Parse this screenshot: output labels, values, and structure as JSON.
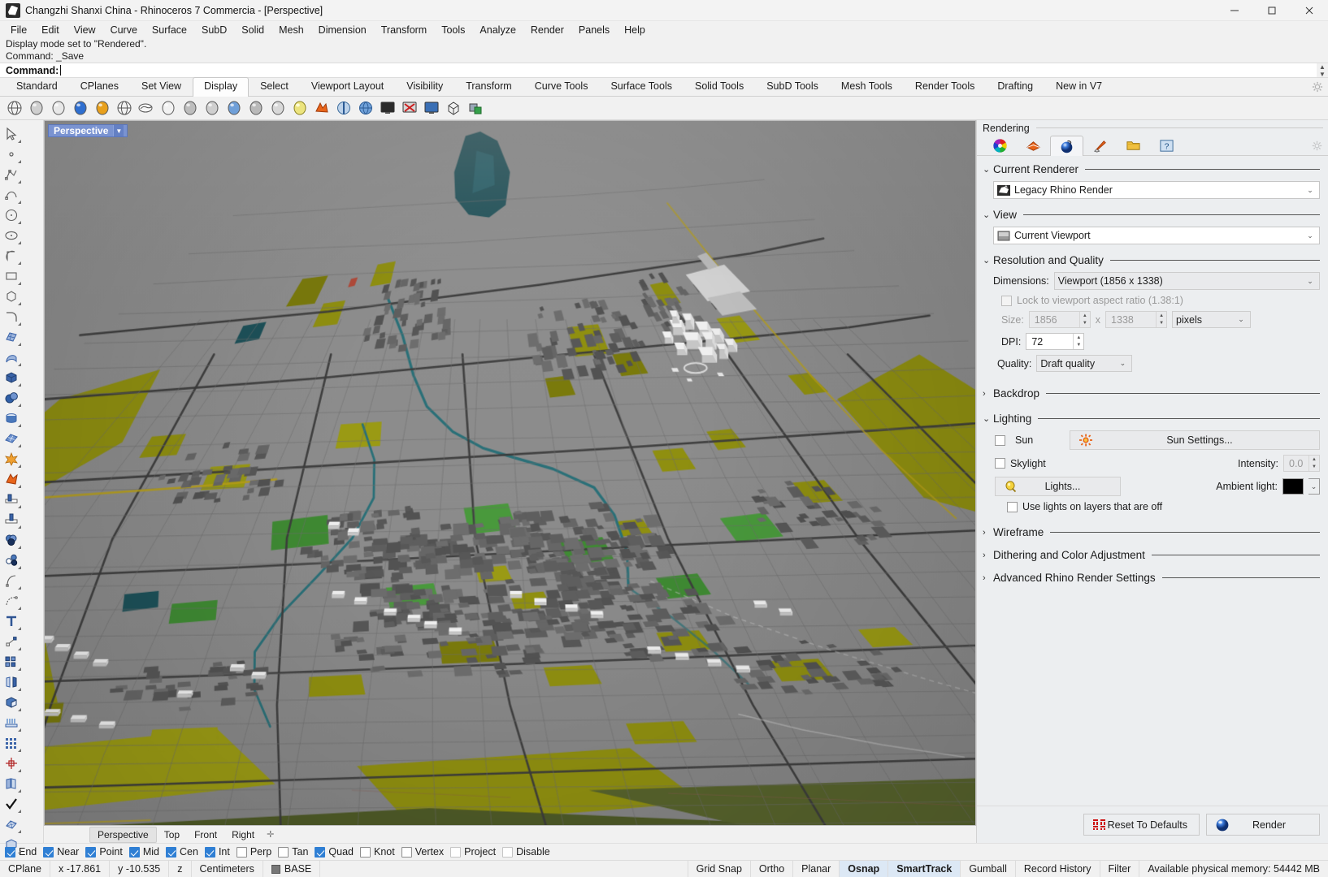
{
  "window": {
    "title": "Changzhi Shanxi China - Rhinoceros 7 Commercia - [Perspective]",
    "app_icon": "rhino-icon",
    "minimize": "—",
    "maximize": "□",
    "close": "✕"
  },
  "menubar": {
    "items": [
      "File",
      "Edit",
      "View",
      "Curve",
      "Surface",
      "SubD",
      "Solid",
      "Mesh",
      "Dimension",
      "Transform",
      "Tools",
      "Analyze",
      "Render",
      "Panels",
      "Help"
    ]
  },
  "command_area": {
    "history": [
      "Display mode set to \"Rendered\".",
      "Command: _Save"
    ],
    "prompt_label": "Command:",
    "prompt_value": ""
  },
  "toolbar_tabs": {
    "items": [
      "Standard",
      "CPlanes",
      "Set View",
      "Display",
      "Select",
      "Viewport Layout",
      "Visibility",
      "Transform",
      "Curve Tools",
      "Surface Tools",
      "Solid Tools",
      "SubD Tools",
      "Mesh Tools",
      "Render Tools",
      "Drafting",
      "New in V7"
    ],
    "active": "Display",
    "options_icon": "gear-icon"
  },
  "display_toolbar": {
    "icons": [
      "wireframe-icon",
      "shaded-icon",
      "ghosted-icon",
      "rendered-icon",
      "artistic-icon",
      "pen-icon",
      "xray-icon",
      "arctic-icon",
      "technical-icon",
      "raytraced-icon",
      "display-mode-icon",
      "shade-selected-icon",
      "flat-shade-icon",
      "monochrome-icon",
      "sun-shade-icon",
      "cplane-shade-icon",
      "environment-icon",
      "clipping-icon",
      "remove-clipping-icon",
      "fullscreen-icon",
      "bounding-box-icon",
      "display-options-icon"
    ]
  },
  "left_palette": {
    "icons": [
      "select-arrow-icon",
      "point-icon",
      "polyline-icon",
      "curve-icon",
      "circle-icon",
      "ellipse-icon",
      "arc-icon",
      "rectangle-icon",
      "polygon-icon",
      "fillet-curve-icon",
      "surface-from-curves-icon",
      "surface-loft-icon",
      "box-icon",
      "sphere-icon",
      "cylinder-icon",
      "surface-patch-icon",
      "explode-icon",
      "boolean-split-icon",
      "trim-icon",
      "extend-icon",
      "boolean-union-icon",
      "boolean-difference-icon",
      "offset-curve-icon",
      "blend-curve-icon",
      "text-icon",
      "point-editing-icon",
      "group-icon",
      "mirror-icon",
      "solid-edit-icon",
      "array-icon",
      "rectangular-array-icon",
      "polar-array-icon",
      "unroll-icon",
      "check-icon",
      "mesh-icon",
      "gumball-icon"
    ]
  },
  "viewport": {
    "label": "Perspective",
    "dropdown_icon": "chevron-down-icon",
    "scene": "Changzhi Shanxi China aerial city model - rendered display mode",
    "tabs": [
      "Perspective",
      "Top",
      "Front",
      "Right"
    ],
    "active_tab": "Perspective",
    "add_tab_icon": "add-viewport-icon"
  },
  "panel": {
    "header": "Rendering",
    "tabs": [
      {
        "name": "materials-tab",
        "icon": "color-wheel-icon",
        "active": false
      },
      {
        "name": "environments-tab",
        "icon": "environment-icon",
        "active": false
      },
      {
        "name": "rendering-tab",
        "icon": "render-sphere-icon",
        "active": true
      },
      {
        "name": "ground-plane-tab",
        "icon": "brush-icon",
        "active": false
      },
      {
        "name": "libraries-tab",
        "icon": "folder-icon",
        "active": false
      },
      {
        "name": "help-tab",
        "icon": "help-icon",
        "active": false
      }
    ],
    "options_icon": "gear-icon",
    "sections": {
      "current_renderer": {
        "title": "Current Renderer",
        "expanded": true,
        "value": "Legacy Rhino Render",
        "icon": "rhino-render-icon"
      },
      "view": {
        "title": "View",
        "expanded": true,
        "value": "Current Viewport",
        "icon": "viewport-icon"
      },
      "resolution_and_quality": {
        "title": "Resolution and Quality",
        "expanded": true,
        "dimensions_label": "Dimensions:",
        "dimensions_value": "Viewport (1856 x 1338)",
        "lock_aspect_label": "Lock to viewport aspect ratio (1.38:1)",
        "lock_aspect_checked": false,
        "size_label": "Size:",
        "size_width": "1856",
        "size_x": "x",
        "size_height": "1338",
        "size_units": "pixels",
        "dpi_label": "DPI:",
        "dpi_value": "72",
        "quality_label": "Quality:",
        "quality_value": "Draft quality"
      },
      "backdrop": {
        "title": "Backdrop",
        "expanded": false
      },
      "lighting": {
        "title": "Lighting",
        "expanded": true,
        "sun_label": "Sun",
        "sun_checked": false,
        "sun_settings_label": "Sun Settings...",
        "sun_icon": "sun-icon",
        "skylight_label": "Skylight",
        "skylight_checked": false,
        "intensity_label": "Intensity:",
        "intensity_value": "0.0",
        "lights_label": "Lights...",
        "lights_icon": "lightbulb-icon",
        "ambient_light_label": "Ambient light:",
        "ambient_light_color": "#000000",
        "use_lights_off_layers_label": "Use lights on layers that are off",
        "use_lights_off_layers_checked": false
      },
      "wireframe": {
        "title": "Wireframe",
        "expanded": false
      },
      "dithering": {
        "title": "Dithering and Color Adjustment",
        "expanded": false
      },
      "advanced": {
        "title": "Advanced Rhino Render Settings",
        "expanded": false
      }
    },
    "footer": {
      "reset_label": "Reset To Defaults",
      "reset_icon": "seven-segment-icon",
      "render_label": "Render",
      "render_icon": "render-sphere-icon"
    }
  },
  "osnap": {
    "items": [
      {
        "label": "End",
        "checked": true
      },
      {
        "label": "Near",
        "checked": true
      },
      {
        "label": "Point",
        "checked": true
      },
      {
        "label": "Mid",
        "checked": true
      },
      {
        "label": "Cen",
        "checked": true
      },
      {
        "label": "Int",
        "checked": true
      },
      {
        "label": "Perp",
        "checked": false
      },
      {
        "label": "Tan",
        "checked": false
      },
      {
        "label": "Quad",
        "checked": true
      },
      {
        "label": "Knot",
        "checked": false
      },
      {
        "label": "Vertex",
        "checked": false
      },
      {
        "label": "Project",
        "checked": false
      },
      {
        "label": "Disable",
        "checked": false
      }
    ]
  },
  "statusbar": {
    "cplane": "CPlane",
    "x": "x -17.861",
    "y": "y -10.535",
    "z": "z",
    "units": "Centimeters",
    "layer": "BASE",
    "layer_color": "#777777",
    "toggles": [
      {
        "label": "Grid Snap",
        "active": false
      },
      {
        "label": "Ortho",
        "active": false
      },
      {
        "label": "Planar",
        "active": false
      },
      {
        "label": "Osnap",
        "active": true
      },
      {
        "label": "SmartTrack",
        "active": true
      },
      {
        "label": "Gumball",
        "active": false
      },
      {
        "label": "Record History",
        "active": false
      },
      {
        "label": "Filter",
        "active": false
      }
    ],
    "memory": "Available physical memory: 54442 MB"
  },
  "colors": {
    "accent": "#2f7fd4",
    "viewport_ground": "#8d8d8d",
    "viewport_field_yellow": "#9a9a10",
    "viewport_field_green": "#4f9a3f",
    "viewport_water": "#1d5159",
    "panel_bg": "#eceef0",
    "chrome_bg": "#f1f1f1"
  }
}
